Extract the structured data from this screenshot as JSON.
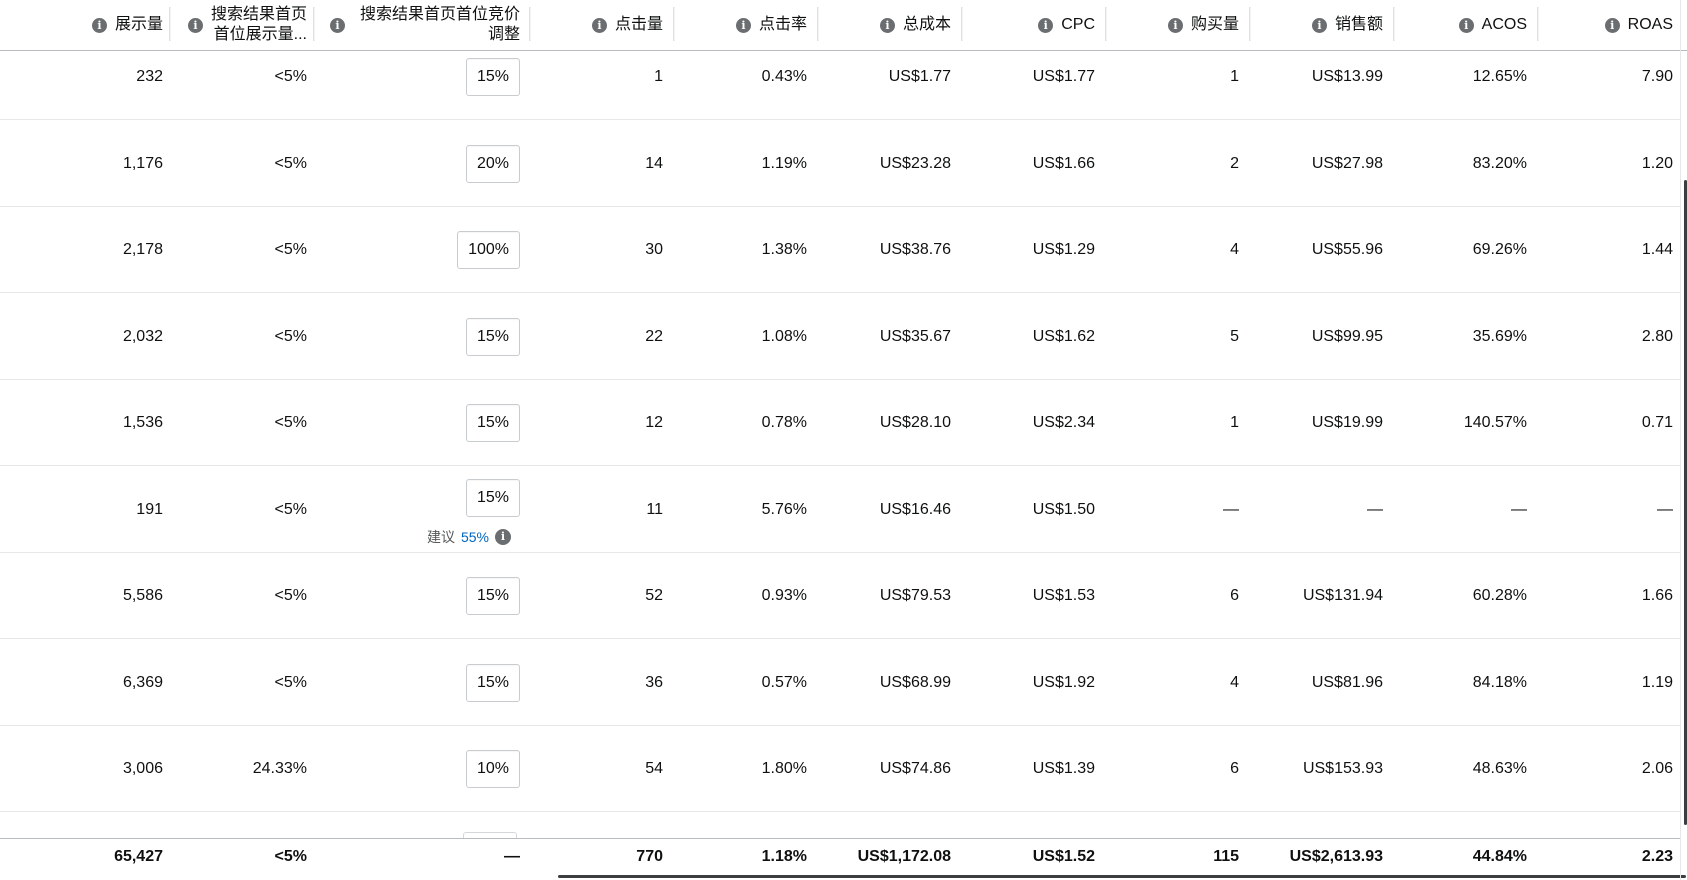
{
  "header": {
    "columns": [
      {
        "label": "展示量"
      },
      {
        "label_line1": "搜索结果首页",
        "label_line2": "首位展示量..."
      },
      {
        "label_line1": "搜索结果首页首位竞价",
        "label_line2": "调整"
      },
      {
        "label": "点击量"
      },
      {
        "label": "点击率"
      },
      {
        "label": "总成本"
      },
      {
        "label": "CPC"
      },
      {
        "label": "购买量"
      },
      {
        "label": "销售额"
      },
      {
        "label": "ACOS"
      },
      {
        "label": "ROAS"
      }
    ]
  },
  "rows": [
    {
      "impressions": "232",
      "tos_share": "<5%",
      "bid_adj": "15%",
      "clicks": "1",
      "ctr": "0.43%",
      "cost": "US$1.77",
      "cpc": "US$1.77",
      "purchases": "1",
      "sales": "US$13.99",
      "acos": "12.65%",
      "roas": "7.90"
    },
    {
      "impressions": "1,176",
      "tos_share": "<5%",
      "bid_adj": "20%",
      "clicks": "14",
      "ctr": "1.19%",
      "cost": "US$23.28",
      "cpc": "US$1.66",
      "purchases": "2",
      "sales": "US$27.98",
      "acos": "83.20%",
      "roas": "1.20"
    },
    {
      "impressions": "2,178",
      "tos_share": "<5%",
      "bid_adj": "100%",
      "clicks": "30",
      "ctr": "1.38%",
      "cost": "US$38.76",
      "cpc": "US$1.29",
      "purchases": "4",
      "sales": "US$55.96",
      "acos": "69.26%",
      "roas": "1.44"
    },
    {
      "impressions": "2,032",
      "tos_share": "<5%",
      "bid_adj": "15%",
      "clicks": "22",
      "ctr": "1.08%",
      "cost": "US$35.67",
      "cpc": "US$1.62",
      "purchases": "5",
      "sales": "US$99.95",
      "acos": "35.69%",
      "roas": "2.80"
    },
    {
      "impressions": "1,536",
      "tos_share": "<5%",
      "bid_adj": "15%",
      "clicks": "12",
      "ctr": "0.78%",
      "cost": "US$28.10",
      "cpc": "US$2.34",
      "purchases": "1",
      "sales": "US$19.99",
      "acos": "140.57%",
      "roas": "0.71"
    },
    {
      "impressions": "191",
      "tos_share": "<5%",
      "bid_adj": "15%",
      "suggest_label": "建议",
      "suggest_value": "55%",
      "clicks": "11",
      "ctr": "5.76%",
      "cost": "US$16.46",
      "cpc": "US$1.50",
      "purchases": "—",
      "sales": "—",
      "acos": "—",
      "roas": "—"
    },
    {
      "impressions": "5,586",
      "tos_share": "<5%",
      "bid_adj": "15%",
      "clicks": "52",
      "ctr": "0.93%",
      "cost": "US$79.53",
      "cpc": "US$1.53",
      "purchases": "6",
      "sales": "US$131.94",
      "acos": "60.28%",
      "roas": "1.66"
    },
    {
      "impressions": "6,369",
      "tos_share": "<5%",
      "bid_adj": "15%",
      "clicks": "36",
      "ctr": "0.57%",
      "cost": "US$68.99",
      "cpc": "US$1.92",
      "purchases": "4",
      "sales": "US$81.96",
      "acos": "84.18%",
      "roas": "1.19"
    },
    {
      "impressions": "3,006",
      "tos_share": "24.33%",
      "bid_adj": "10%",
      "clicks": "54",
      "ctr": "1.80%",
      "cost": "US$74.86",
      "cpc": "US$1.39",
      "purchases": "6",
      "sales": "US$153.93",
      "acos": "48.63%",
      "roas": "2.06"
    }
  ],
  "totals": {
    "impressions": "65,427",
    "tos_share": "<5%",
    "bid_adj": "—",
    "clicks": "770",
    "ctr": "1.18%",
    "cost": "US$1,172.08",
    "cpc": "US$1.52",
    "purchases": "115",
    "sales": "US$2,613.93",
    "acos": "44.84%",
    "roas": "2.23"
  },
  "icons": {
    "info": "info-icon"
  },
  "colors": {
    "text": "#0f1111",
    "link": "#0066c0",
    "icon": "#6b6e70",
    "border": "#e6e7e8"
  }
}
